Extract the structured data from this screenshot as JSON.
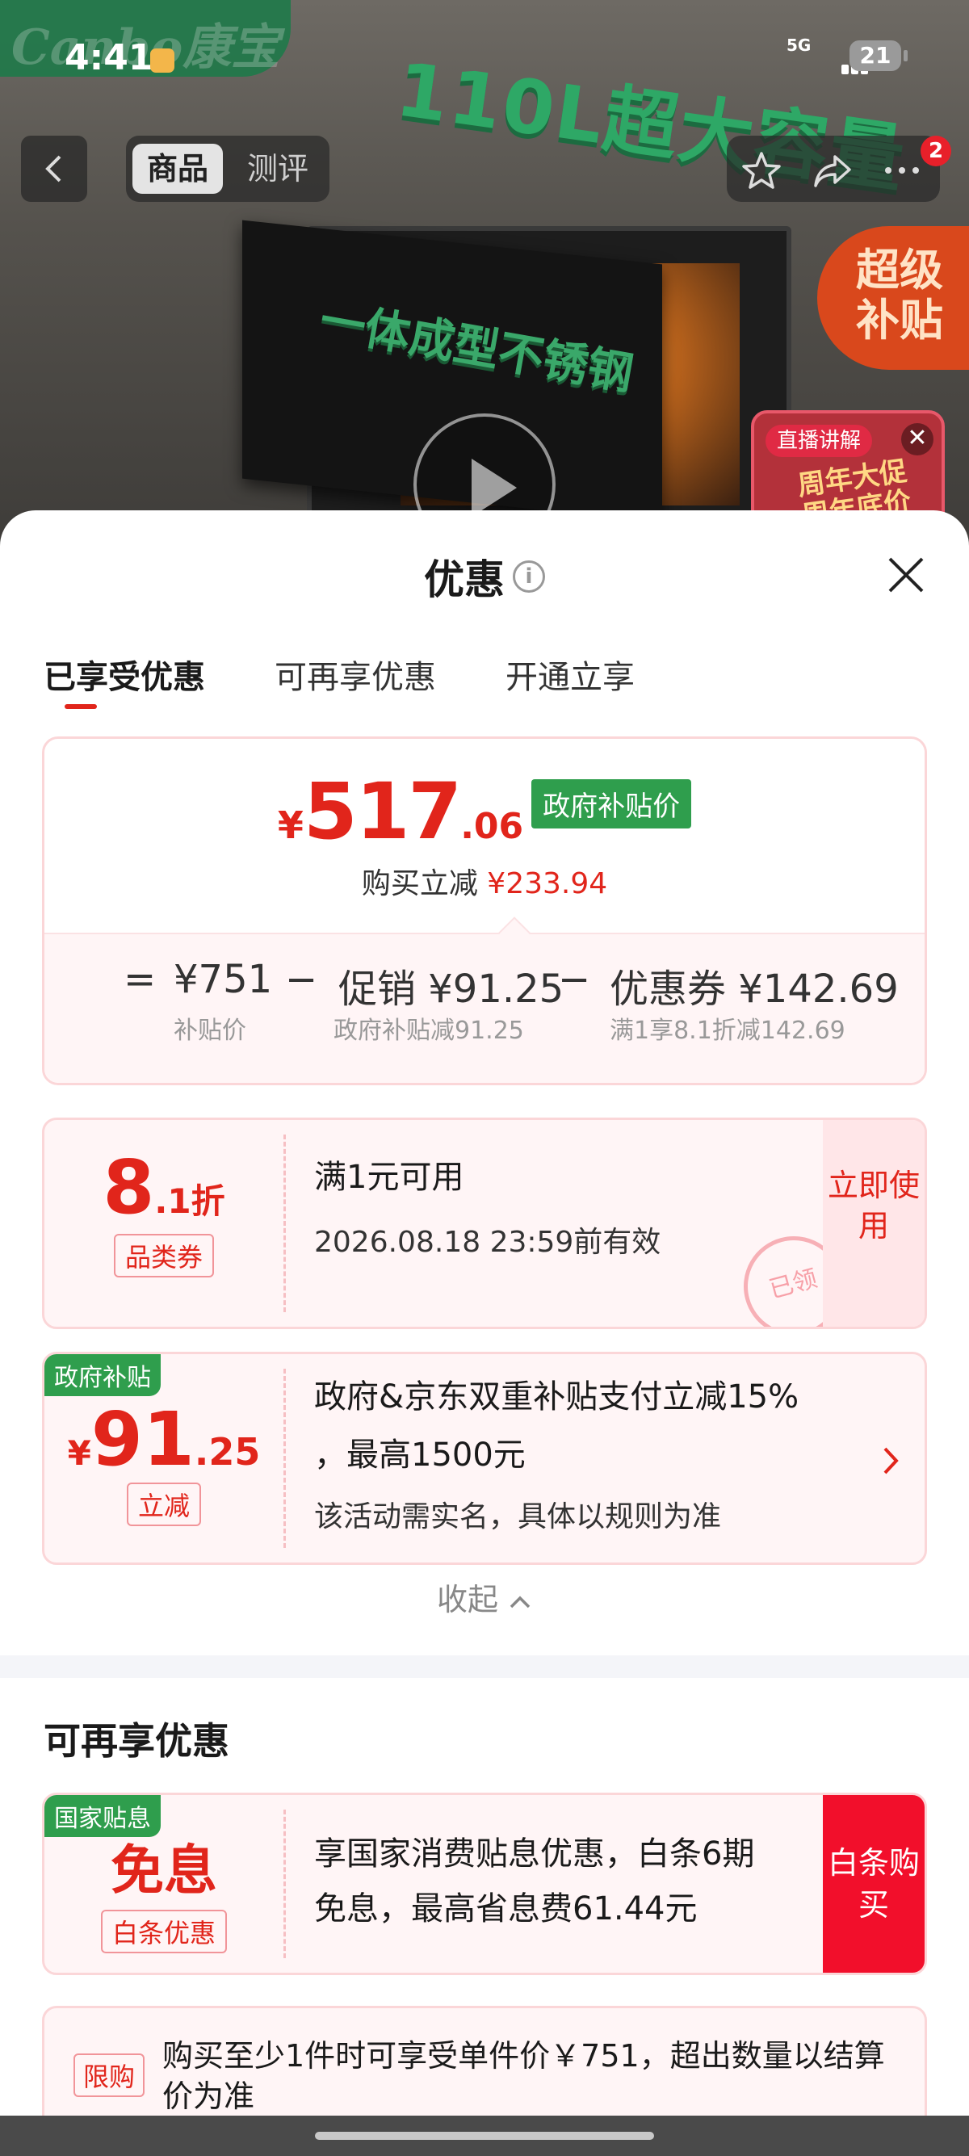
{
  "status_bar": {
    "time": "4:41",
    "network": "5G",
    "battery": "21"
  },
  "hero": {
    "brand_text": "Canbo康宝",
    "headline": "110L超大容量",
    "tagline": "一体成型不锈钢",
    "super_subsidy": "超级补贴",
    "live_tag": "直播讲解",
    "live_promo": "周年大促 周年底价",
    "live_close": "✕"
  },
  "nav": {
    "tabs": [
      "商品",
      "测评"
    ],
    "badge_count": "2"
  },
  "sheet": {
    "title": "优惠",
    "info_glyph": "i",
    "tabs": [
      "已享受优惠",
      "可再享优惠",
      "开通立享"
    ]
  },
  "price_summary": {
    "currency": "¥",
    "price_int": "517",
    "price_dec": ".06",
    "price_tag": "政府补贴价",
    "reduce_label": "购买立减",
    "reduce_value": "¥233.94",
    "formula": {
      "eq": "=",
      "base_value": "¥751",
      "base_label": "补贴价",
      "minus1": "−",
      "promo_value": "促销 ¥91.25",
      "promo_label": "政府补贴减91.25",
      "minus2": "−",
      "coupon_value": "优惠券 ¥142.69",
      "coupon_label": "满1享8.1折减142.69"
    }
  },
  "coupon_1": {
    "discount_int": "8",
    "discount_dec": ".1折",
    "chip": "品类券",
    "title": "满1元可用",
    "expiry": "2026.08.18 23:59前有效",
    "action": "立即使用",
    "stamp": "已领"
  },
  "coupon_2": {
    "corner_tag": "政府补贴",
    "currency": "¥",
    "amount_int": "91",
    "amount_dec": ".25",
    "chip": "立减",
    "title_line1": "政府&京东双重补贴支付立减15%",
    "title_line2": "，最高1500元",
    "note": "该活动需实名，具体以规则为准"
  },
  "collapse_label": "收起",
  "more_section": {
    "title": "可再享优惠",
    "card": {
      "corner_tag": "国家贴息",
      "headline": "免息",
      "chip": "白条优惠",
      "line1": "享国家消费贴息优惠，白条6期",
      "line2": "免息，最高省息费61.44元",
      "action": "白条购买"
    },
    "limit": {
      "label": "限购",
      "text": "购买至少1件时可享受单件价￥751，超出数量以结算价为准"
    }
  },
  "colors": {
    "accent": "#e1251b",
    "gov_green": "#2f9e4d",
    "buy_red": "#f20f2b"
  }
}
